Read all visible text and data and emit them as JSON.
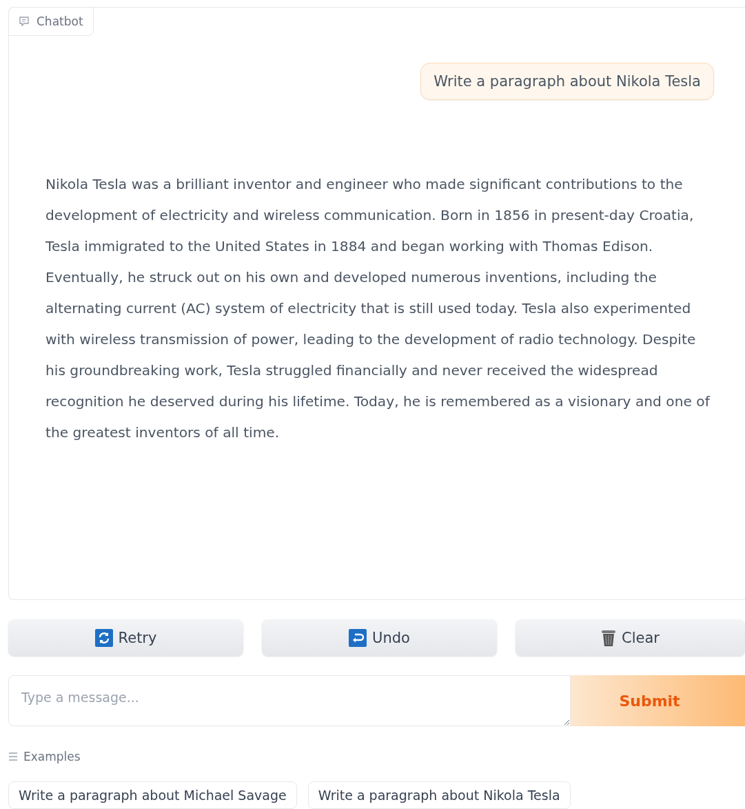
{
  "chatbot": {
    "label": "Chatbot",
    "messages": [
      {
        "kind": "user",
        "text": "Write a paragraph about Nikola Tesla"
      },
      {
        "kind": "bot",
        "text": "Nikola Tesla was a brilliant inventor and engineer who made significant contributions to the development of electricity and wireless communication. Born in 1856 in present-day Croatia, Tesla immigrated to the United States in 1884 and began working with Thomas Edison. Eventually, he struck out on his own and developed numerous inventions, including the alternating current (AC) system of electricity that is still used today. Tesla also experimented with wireless transmission of power, leading to the development of radio technology. Despite his groundbreaking work, Tesla struggled financially and never received the widespread recognition he deserved during his lifetime. Today, he is remembered as a visionary and one of the greatest inventors of all time."
      }
    ]
  },
  "actions": [
    {
      "kind": "retry",
      "label": "Retry"
    },
    {
      "kind": "undo",
      "label": "Undo"
    },
    {
      "kind": "clear",
      "label": "Clear"
    }
  ],
  "input": {
    "placeholder": "Type a message..."
  },
  "submit": "Submit",
  "examples": {
    "label": "Examples",
    "items": [
      "Write a paragraph about Michael Savage",
      "Write a paragraph about Nikola Tesla"
    ]
  }
}
